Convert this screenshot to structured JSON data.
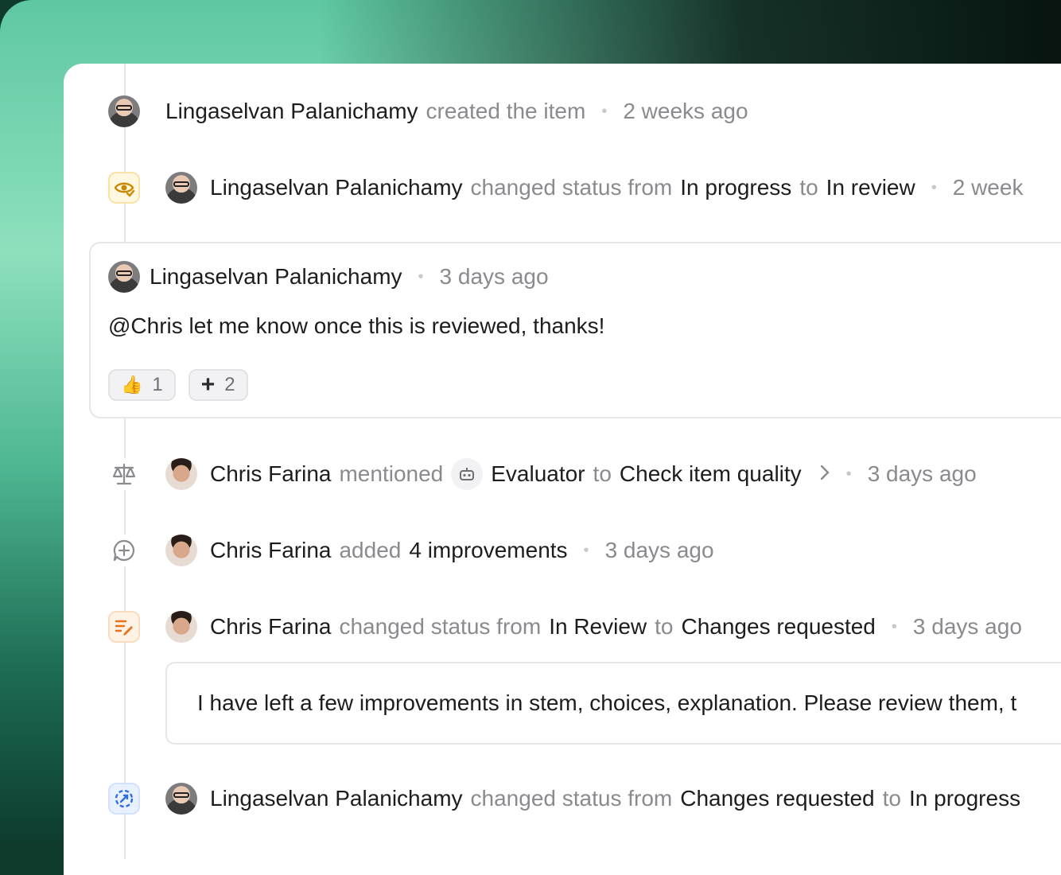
{
  "colors": {
    "accent_amber": "#e0a100",
    "accent_orange": "#e8731a",
    "accent_blue": "#2f6fe4",
    "muted_text": "#8a8a8f"
  },
  "activity": [
    {
      "actor": "Lingaselvan Palanichamy",
      "text": "created the item",
      "time": "2 weeks ago"
    },
    {
      "icon": "eye-check-icon",
      "actor": "Lingaselvan Palanichamy",
      "pre": "changed status from",
      "from": "In progress",
      "mid": "to",
      "to": "In review",
      "time": "2 week"
    },
    {
      "comment": {
        "actor": "Lingaselvan Palanichamy",
        "time": "3 days ago",
        "mention": "@Chris",
        "body": " let me know once this is reviewed, thanks!",
        "reactions": [
          {
            "icon": "thumbs-up-icon",
            "count": "1"
          },
          {
            "icon": "plus-icon",
            "count": "2"
          }
        ]
      }
    },
    {
      "icon": "scale-icon",
      "actor": "Chris Farina",
      "pre": "mentioned",
      "agent_icon": "robot-icon",
      "agent": "Evaluator",
      "mid": "to",
      "task": "Check item quality",
      "time": "3 days ago"
    },
    {
      "icon": "comment-plus-icon",
      "actor": "Chris Farina",
      "pre": "added",
      "count_label": "4 improvements",
      "time": "3 days ago"
    },
    {
      "icon": "list-edit-icon",
      "actor": "Chris Farina",
      "pre": "changed status from",
      "from": "In Review",
      "mid": "to",
      "to": "Changes requested",
      "time": "3 days ago",
      "note": "I have left a few improvements in stem, choices, explanation. Please review them, t"
    },
    {
      "icon": "progress-icon",
      "actor": "Lingaselvan Palanichamy",
      "pre": "changed status from",
      "from": "Changes requested",
      "mid": "to",
      "to": "In progress"
    }
  ]
}
